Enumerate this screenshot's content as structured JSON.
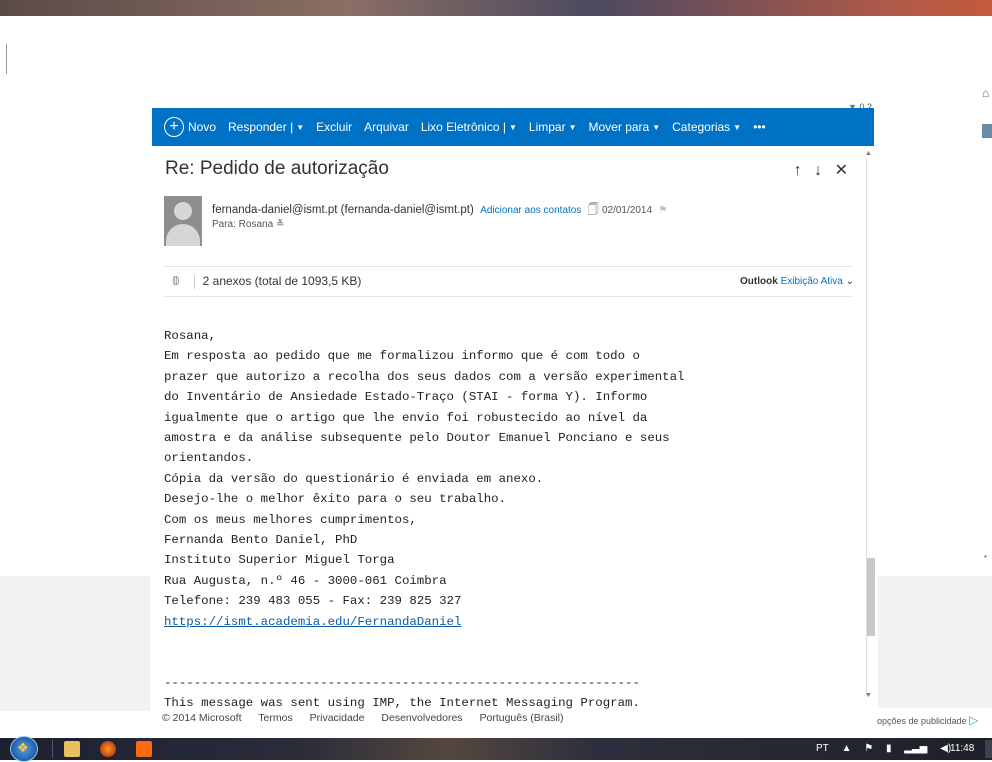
{
  "toolbar": {
    "new_label": "Novo",
    "reply_label": "Responder",
    "delete_label": "Excluir",
    "archive_label": "Arquivar",
    "junk_label": "Lixo Eletrônico",
    "sweep_label": "Limpar",
    "move_label": "Mover para",
    "categories_label": "Categorias",
    "more_label": "•••"
  },
  "message": {
    "subject": "Re: Pedido de autorização",
    "nav_arrows": "↑ ↓ ✕",
    "sender": "fernanda-daniel@ismt.pt",
    "sender_full": "(fernanda-daniel@ismt.pt)",
    "add_contacts": "Adicionar aos contatos",
    "date": "02/01/2014",
    "to": "Para: Rosana",
    "to_caret": "≚",
    "attachments_text": "2 anexos (total de 1093,5 KB)",
    "viewer_brand": "Outlook",
    "viewer_label": "Exibição Ativa",
    "viewer_caret": "⌄",
    "body_lines": [
      "Rosana,",
      "Em resposta ao pedido que me formalizou informo que é com todo o",
      "prazer que autorizo a recolha dos seus dados com a versão experimental",
      "do Inventário de Ansiedade Estado-Traço (STAI - forma Y). Informo",
      "igualmente que o artigo que lhe envio foi robustecido ao nível da",
      "amostra e da análise subsequente pelo Doutor Emanuel Ponciano e seus",
      "orientandos.",
      "Cópia da versão do questionário é enviada em anexo.",
      "Desejo-lhe o melhor êxito para o seu trabalho.",
      "Com os meus melhores cumprimentos,",
      "Fernanda Bento Daniel, PhD",
      "Instituto Superior Miguel Torga",
      "Rua Augusta, n.º 46 - 3000-061 Coimbra",
      "Telefone: 239 483 055 - Fax: 239 825 327"
    ],
    "link": "https://ismt.academia.edu/FernandaDaniel",
    "divider": "----------------------------------------------------------------",
    "footer_line": "This message was sent using IMP, the Internet Messaging Program."
  },
  "footer": {
    "copyright": "© 2014 Microsoft",
    "terms": "Termos",
    "privacy": "Privacidade",
    "developers": "Desenvolvedores",
    "language": "Português (Brasil)"
  },
  "ads": {
    "options_label": "opções de publicidade"
  },
  "side": {
    "badge_text": "0.2"
  },
  "taskbar": {
    "language": "PT",
    "clock": "11:48"
  },
  "colors": {
    "accent": "#0072c6",
    "link": "#0b5aa8"
  }
}
